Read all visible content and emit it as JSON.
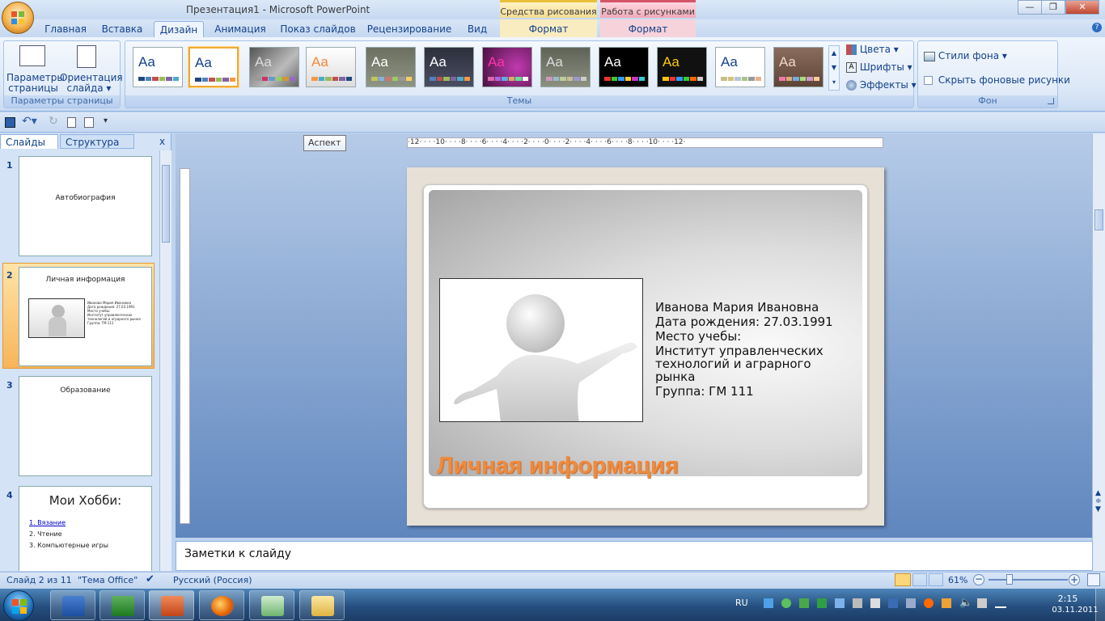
{
  "window": {
    "title": "Презентация1 - Microsoft PowerPoint",
    "context_draw": "Средства рисования",
    "context_picture": "Работа с рисунками",
    "minimize": "—",
    "maximize": "❐",
    "close": "✕"
  },
  "tabs": [
    {
      "label": "Главная"
    },
    {
      "label": "Вставка"
    },
    {
      "label": "Дизайн"
    },
    {
      "label": "Анимация"
    },
    {
      "label": "Показ слайдов"
    },
    {
      "label": "Рецензирование"
    },
    {
      "label": "Вид"
    }
  ],
  "context_tabs": {
    "draw_format": "Формат",
    "picture_format": "Формат"
  },
  "ribbon": {
    "page_setup": {
      "btn_params_line1": "Параметры",
      "btn_params_line2": "страницы",
      "btn_orient_line1": "Ориентация",
      "btn_orient_line2": "слайда ▾",
      "group_label": "Параметры страницы"
    },
    "themes": {
      "group_label": "Темы",
      "thumb_text": "Aa",
      "colors": "Цвета ▾",
      "fonts": "Шрифты ▾",
      "effects": "Эффекты ▾"
    },
    "background": {
      "styles": "Стили фона ▾",
      "hide_graphics": "Скрыть фоновые рисунки",
      "group_label": "Фон"
    }
  },
  "tooltip": "Аспект",
  "left_pane": {
    "tab_slides": "Слайды",
    "tab_outline": "Структура",
    "close": "x",
    "slides": [
      {
        "num": "1",
        "title": "Автобиография"
      },
      {
        "num": "2",
        "title": "Личная информация",
        "mini_text": "Иванова Мария Ивановна\nДата рождения: 27.03.1991\nМесто учебы:\nИнститут управленческих\nтехнологий и аграрного рынка\nГруппа: ГМ 111"
      },
      {
        "num": "3",
        "title": "Образование"
      },
      {
        "num": "4",
        "title": "Мои Хобби:",
        "items": [
          "1. Вязание",
          "2. Чтение",
          "3. Компьютерные игры"
        ]
      }
    ]
  },
  "slide": {
    "name": "Иванова Мария Ивановна",
    "dob": "Дата рождения:  27.03.1991",
    "study_label": "Место учебы:",
    "institute": "Институт управленческих технологий и аграрного рынка",
    "group": "Группа: ГМ 111",
    "title": "Личная информация"
  },
  "ruler_h": "·12· · · ·10· · · ·8· · · ·6· · · ·4· · · ·2· · · ·0· · · ·2· · · ·4· · · ·6· · · ·8· · · ·10· · · ·12·",
  "notes_placeholder": "Заметки к слайду",
  "status": {
    "slide_counter": "Слайд 2 из 11",
    "theme": "\"Тема Office\"",
    "language": "Русский (Россия)",
    "zoom": "61%"
  },
  "taskbar": {
    "lang": "RU",
    "time": "2:15",
    "date": "03.11.2011"
  },
  "colors": {
    "accent_orange": "#f08a3c",
    "ribbon_blue": "#15428b"
  }
}
